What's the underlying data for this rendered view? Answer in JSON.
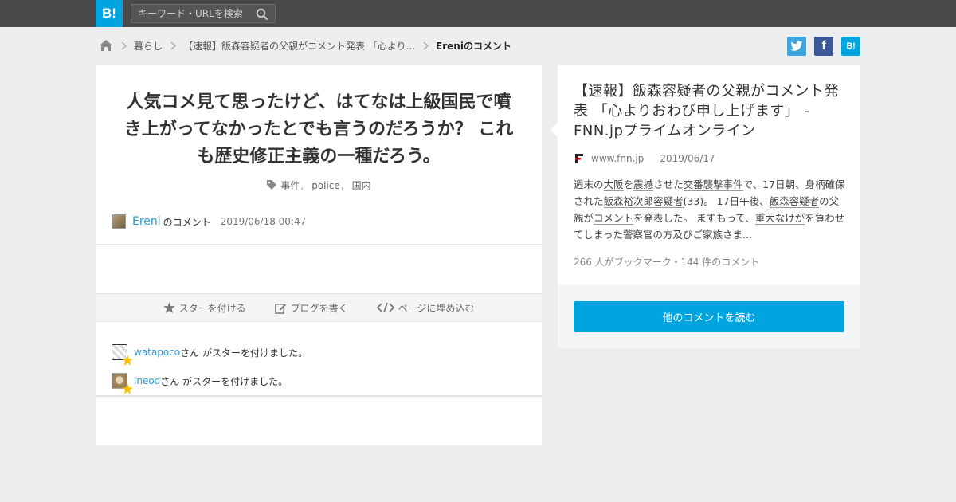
{
  "header": {
    "logo_label": "B!",
    "search": {
      "placeholder": "キーワード・URLを検索"
    }
  },
  "breadcrumb": {
    "items": [
      "暮らし",
      "【速報】飯森容疑者の父親がコメント発表 「心より...",
      "Ereniのコメント"
    ]
  },
  "share": {
    "twitter": "twitter",
    "facebook_label": "f",
    "hatena_label": "B!"
  },
  "comment": {
    "text": "人気コメ見て思ったけど、はてなは上級国民で噴き上がってなかったとでも言うのだろうか？ これも歴史修正主義の一種だろう。",
    "tags": [
      "事件",
      "police",
      "国内"
    ],
    "tag_separator": ",",
    "user": "Ereni",
    "of_comment": "のコメント",
    "timestamp": "2019/06/18 00:47"
  },
  "actions": {
    "star_label": "スターを付ける",
    "blog_label": "ブログを書く",
    "embed_label": "ページに埋め込む"
  },
  "stars": [
    {
      "user": "watapoco",
      "suffix": "さん がスターを付けました。"
    },
    {
      "user": "ineod",
      "suffix": "さん がスターを付けました。"
    }
  ],
  "entry": {
    "title": "【速報】飯森容疑者の父親がコメント発表 「心よりおわび申し上げます」 - FNN.jpプライムオンライン",
    "domain": "www.fnn.jp",
    "date": "2019/06/17",
    "summary": {
      "p1": "週末の",
      "k1": "大阪",
      "p2": "を",
      "k2": "震撼",
      "p3": "させた",
      "k3": "交番襲撃事件",
      "p4": "で、17日朝、身柄確保された",
      "k4": "飯森裕次郎容疑者",
      "p5": "(33)。 17日午後、",
      "k5": "飯森容疑者",
      "p6": "の父親が",
      "k6": "コメント",
      "p7": "を発表した。 まずもって、",
      "k7": "重大なけが",
      "p8": "を負わせてしまった",
      "k8": "警察官",
      "p9": "の方及びご家族さま..."
    },
    "count_text": "266 人がブックマーク・144 件のコメント"
  },
  "read_more_label": "他のコメントを読む",
  "colors": {
    "brand": "#00a4de",
    "link": "#2b9cd8",
    "star": "#f5c400"
  }
}
